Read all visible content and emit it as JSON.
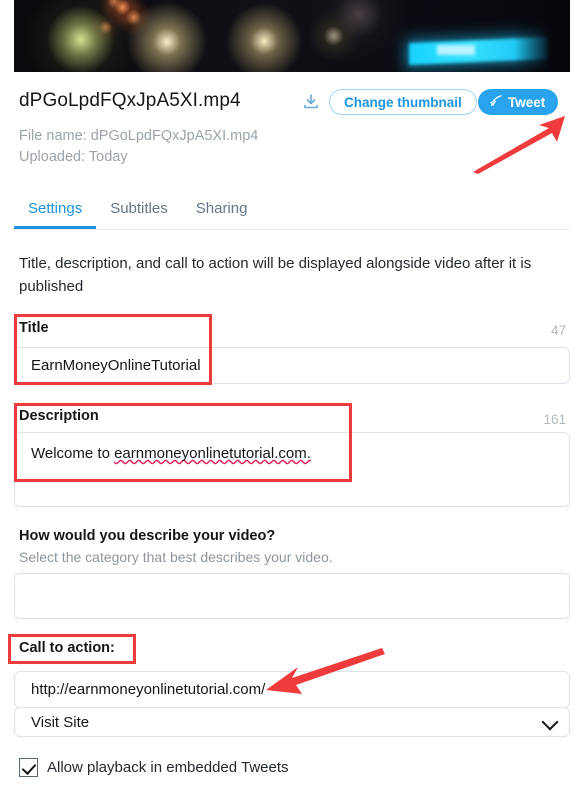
{
  "video": {
    "thumbnail_alt": "video-thumbnail-night-scene",
    "file_title": "dPGoLpdFQxJpA5XI.mp4",
    "file_name_label": "File name: dPGoLpdFQxJpA5XI.mp4",
    "uploaded_label": "Uploaded: Today"
  },
  "header_actions": {
    "download_icon": "download-icon",
    "change_thumbnail_label": "Change thumbnail",
    "tweet_label": "Tweet",
    "tweet_icon": "quill-pen-icon"
  },
  "tabs": [
    {
      "label": "Settings",
      "active": true
    },
    {
      "label": "Subtitles",
      "active": false
    },
    {
      "label": "Sharing",
      "active": false
    }
  ],
  "intro_text": "Title, description, and call to action will be displayed alongside video after it is published",
  "form": {
    "title": {
      "label": "Title",
      "value": "EarnMoneyOnlineTutorial",
      "placeholder": "",
      "counter": "47"
    },
    "description": {
      "label": "Description",
      "value": "Welcome to earnmoneyonlinetutorial.com.",
      "value_plain": "Welcome to ",
      "value_misspelled": "earnmoneyonlinetutorial.com.",
      "placeholder": "",
      "counter": "161"
    },
    "category": {
      "label": "How would you describe your video?",
      "sublabel": "Select the category that best describes your video.",
      "value": "",
      "placeholder": ""
    },
    "call_to_action": {
      "label": "Call to action:",
      "url_value": "http://earnmoneyonlinetutorial.com/",
      "url_placeholder": "",
      "action_selected": "Visit Site",
      "action_options": [
        "Visit Site"
      ],
      "chevron_icon": "chevron-down-icon"
    },
    "allow_playback": {
      "label": "Allow playback in embedded Tweets",
      "checked": true
    }
  },
  "annotations": {
    "color": "#ef3b3b",
    "boxes": [
      "title-highlight",
      "description-highlight",
      "call-to-action-highlight"
    ],
    "arrows": [
      "arrow-to-tweet-button",
      "arrow-to-cta-url-field"
    ]
  },
  "colors": {
    "accent_blue": "#1b95e0",
    "tweet_blue": "#29a3ee",
    "annotation_red": "#ef3b3b",
    "muted_text": "#9aa3ab",
    "border": "#dde3e8"
  }
}
